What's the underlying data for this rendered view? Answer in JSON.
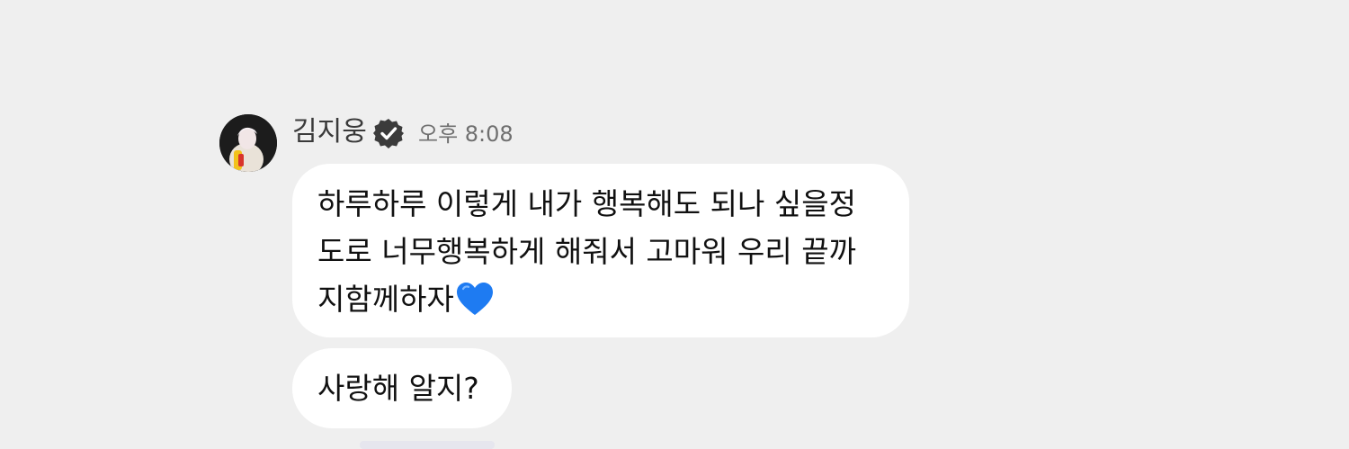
{
  "message": {
    "sender": {
      "name": "김지웅",
      "verified_icon": "verified-badge-icon",
      "avatar_icon": "profile-avatar"
    },
    "time": "오후 8:08",
    "bubbles": [
      {
        "lines": [
          "하루하루 이렇게 내가 행복해도 되나 싶을정",
          "도로 너무행복하게 해줘서 고마워 우리 끝까",
          "지함께하자"
        ],
        "emoji": "blue-heart-icon"
      },
      {
        "lines": [
          "사랑해 알지?"
        ]
      }
    ]
  },
  "colors": {
    "background": "#efefef",
    "bubble": "#ffffff",
    "heart": "#1e7bf2"
  }
}
